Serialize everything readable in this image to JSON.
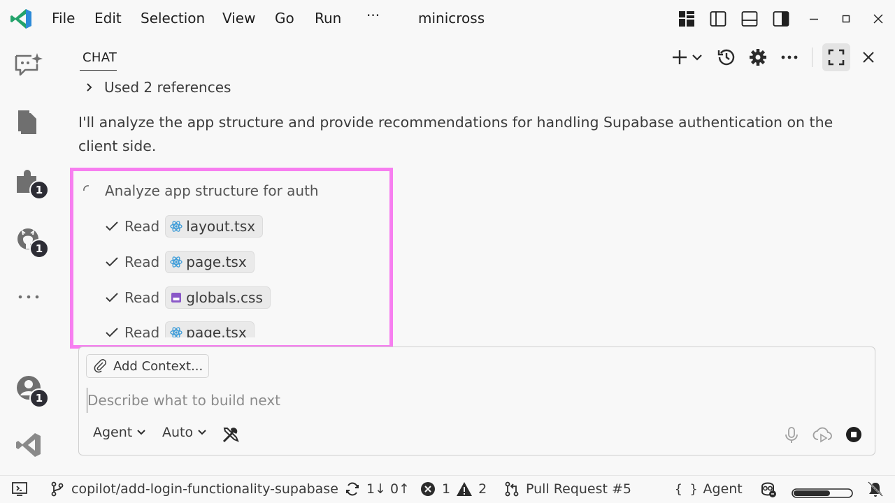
{
  "window": {
    "title": "minicross",
    "menu": [
      "File",
      "Edit",
      "Selection",
      "View",
      "Go",
      "Run",
      "···"
    ]
  },
  "activity_bar": {
    "badges": {
      "extensions": "1",
      "github": "1",
      "account": "1"
    }
  },
  "chat": {
    "tab_label": "CHAT",
    "references_label": "Used 2 references",
    "reply_text": "I'll analyze the app structure and provide recommendations for handling Supabase authentication on the client side.",
    "task": {
      "title": "Analyze app structure for auth",
      "items": [
        {
          "verb": "Read",
          "file": "layout.tsx",
          "kind": "react"
        },
        {
          "verb": "Read",
          "file": "page.tsx",
          "kind": "react"
        },
        {
          "verb": "Read",
          "file": "globals.css",
          "kind": "css"
        },
        {
          "verb": "Read",
          "file": "page.tsx",
          "kind": "react"
        }
      ]
    }
  },
  "input": {
    "add_context_label": "Add Context...",
    "placeholder": "Describe what to build next",
    "mode_label": "Agent",
    "model_label": "Auto"
  },
  "status_bar": {
    "branch": "copilot/add-login-functionality-supabase",
    "sync": "1↓ 0↑",
    "errors": "1",
    "warnings": "2",
    "pull_request": "Pull Request #5",
    "language_mode": "Agent"
  },
  "colors": {
    "highlight_border": "#f77ef0",
    "react_icon": "#3b9bd8",
    "css_icon": "#8a58c8",
    "vscode_blue": "#2c8ad8",
    "vscode_green": "#23a36b"
  }
}
